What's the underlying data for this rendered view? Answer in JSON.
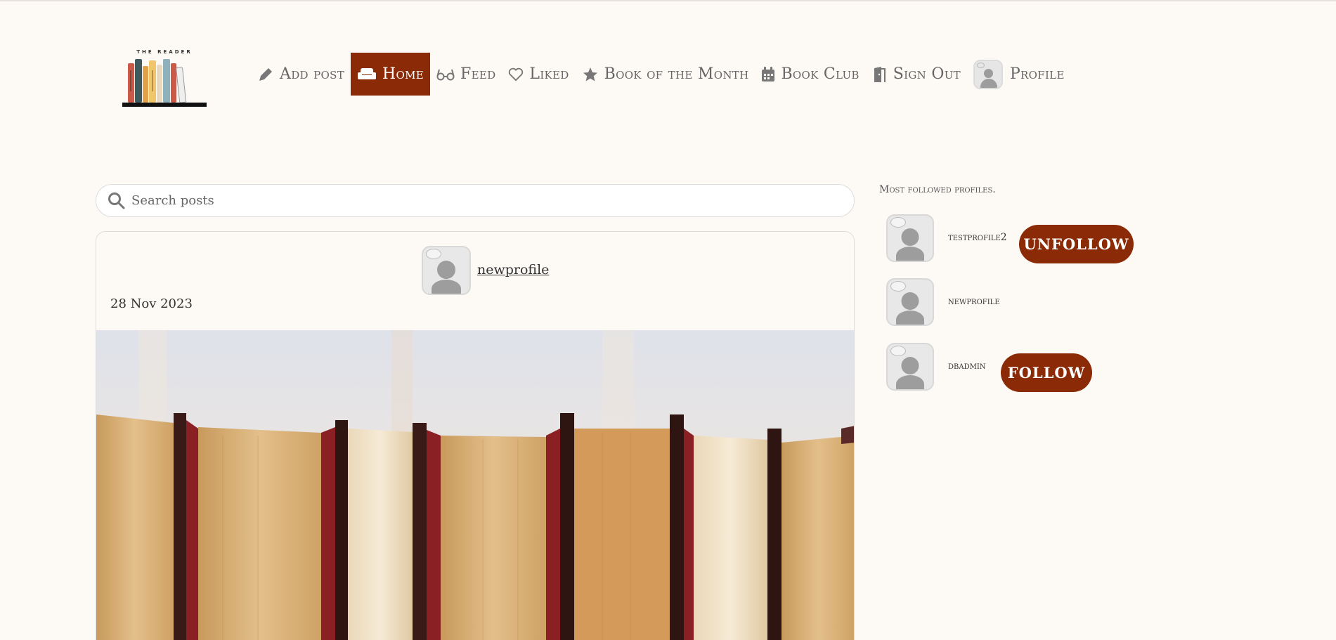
{
  "logo": {
    "text": "THE READER"
  },
  "nav": {
    "items": [
      {
        "label": "Add post",
        "icon": "pen-icon"
      },
      {
        "label": "Home",
        "icon": "couch-icon",
        "active": true
      },
      {
        "label": "Feed",
        "icon": "glasses-icon"
      },
      {
        "label": "Liked",
        "icon": "heart-icon"
      },
      {
        "label": "Book of the Month",
        "icon": "star-icon"
      },
      {
        "label": "Book Club",
        "icon": "calendar-icon"
      },
      {
        "label": "Sign Out",
        "icon": "door-icon"
      },
      {
        "label": "Profile",
        "icon": "avatar-icon"
      }
    ]
  },
  "search": {
    "placeholder": "Search posts"
  },
  "post": {
    "username": "newprofile",
    "date": "28 Nov 2023"
  },
  "sidebar": {
    "title": "Most followed profiles.",
    "profiles": [
      {
        "name": "testprofile2",
        "button": "UNFOLLOW"
      },
      {
        "name": "newprofile",
        "button": ""
      },
      {
        "name": "dbadmin",
        "button": "FOLLOW"
      }
    ]
  },
  "colors": {
    "accent": "#8b2a06",
    "background": "#fdf9f5"
  }
}
